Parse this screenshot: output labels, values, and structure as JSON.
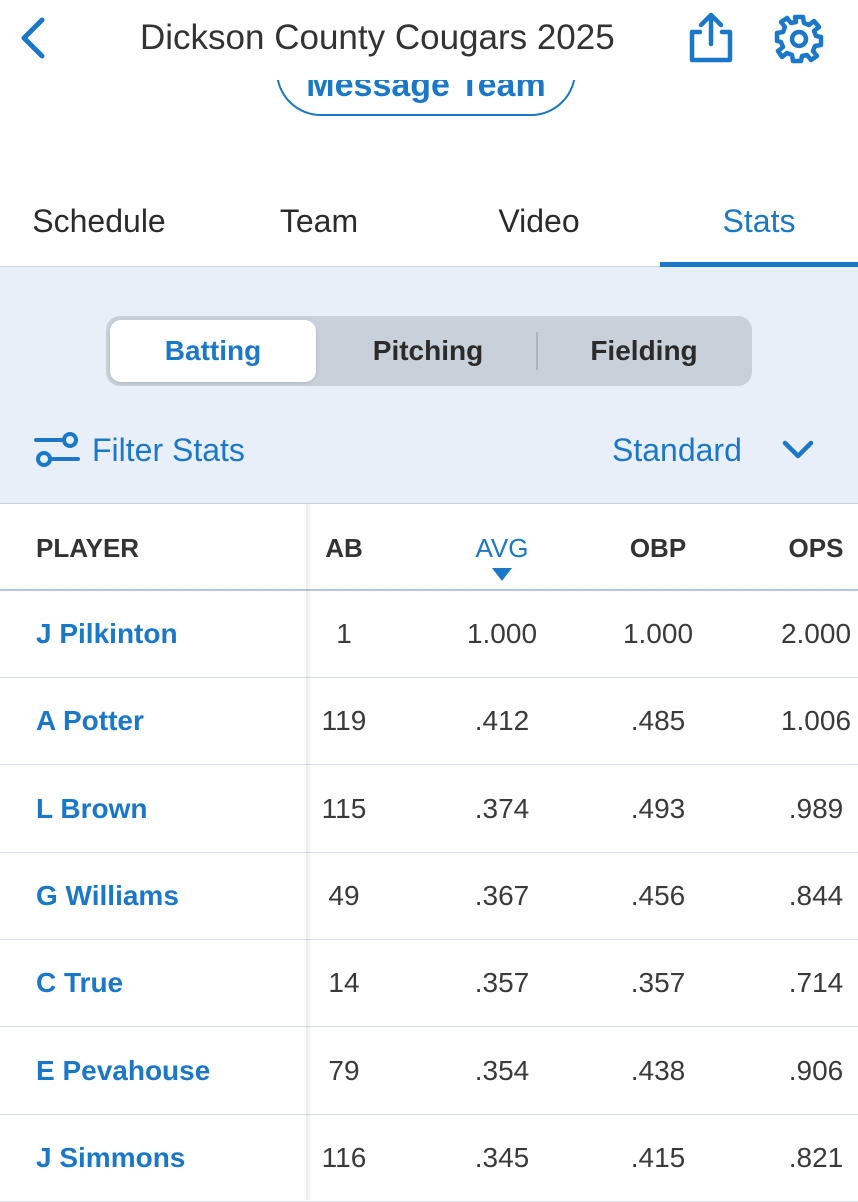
{
  "header": {
    "title": "Dickson County Cougars 2025"
  },
  "message_button": "Message Team",
  "tabs": [
    {
      "label": "Schedule",
      "active": false
    },
    {
      "label": "Team",
      "active": false
    },
    {
      "label": "Video",
      "active": false
    },
    {
      "label": "Stats",
      "active": true
    }
  ],
  "segments": [
    {
      "label": "Batting",
      "active": true
    },
    {
      "label": "Pitching",
      "active": false
    },
    {
      "label": "Fielding",
      "active": false
    }
  ],
  "filter": {
    "label": "Filter Stats",
    "view_selected": "Standard"
  },
  "table": {
    "columns": [
      "PLAYER",
      "AB",
      "AVG",
      "OBP",
      "OPS"
    ],
    "sorted_column": "AVG",
    "sort_direction": "descending",
    "rows": [
      {
        "player": "J Pilkinton",
        "ab": "1",
        "avg": "1.000",
        "obp": "1.000",
        "ops": "2.000"
      },
      {
        "player": "A Potter",
        "ab": "119",
        "avg": ".412",
        "obp": ".485",
        "ops": "1.006"
      },
      {
        "player": "L Brown",
        "ab": "115",
        "avg": ".374",
        "obp": ".493",
        "ops": ".989"
      },
      {
        "player": "G Williams",
        "ab": "49",
        "avg": ".367",
        "obp": ".456",
        "ops": ".844"
      },
      {
        "player": "C True",
        "ab": "14",
        "avg": ".357",
        "obp": ".357",
        "ops": ".714"
      },
      {
        "player": "E Pevahouse",
        "ab": "79",
        "avg": ".354",
        "obp": ".438",
        "ops": ".906"
      },
      {
        "player": "J Simmons",
        "ab": "116",
        "avg": ".345",
        "obp": ".415",
        "ops": ".821"
      }
    ]
  },
  "colors": {
    "accent": "#1b78c8",
    "panel_background": "#e9eff8",
    "segment_background": "#c8d0da"
  },
  "icons": {
    "back": "chevron-left-icon",
    "share": "share-icon",
    "settings": "gear-icon",
    "filter": "sliders-icon",
    "dropdown": "chevron-down-icon",
    "sort": "sort-descending-icon"
  }
}
